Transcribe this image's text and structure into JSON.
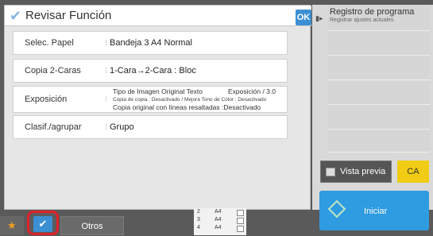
{
  "dialog": {
    "title": "Revisar Función",
    "ok_label": "OK",
    "rows": [
      {
        "label": "Selec. Papel",
        "value": "Bandeja 3 A4 Normal"
      },
      {
        "label": "Copia 2-Caras",
        "value": "1-Cara→2-Cara : Bloc"
      },
      {
        "label": "Exposición",
        "line1_a": "Tipo de Imagen Original Texto",
        "line1_b": "Exposición / 3.0",
        "line2": "Copia de copia : Desactivado / Mejora Tono de Color : Desactivado",
        "line3": "Copia original con líneas resaltadas :Desactivado"
      },
      {
        "label": "Clasif./agrupar",
        "value": "Grupo"
      }
    ]
  },
  "right_panel": {
    "title": "Registro de programa",
    "subtitle": "Registrar ajustes actuales",
    "preview_label": "Vista previa",
    "ca_label": "CA",
    "start_label": "Iniciar"
  },
  "bottom": {
    "otros_label": "Otros",
    "trays": [
      {
        "num": "2",
        "size": "A4"
      },
      {
        "num": "3",
        "size": "A4"
      },
      {
        "num": "4",
        "size": "A4"
      }
    ]
  }
}
